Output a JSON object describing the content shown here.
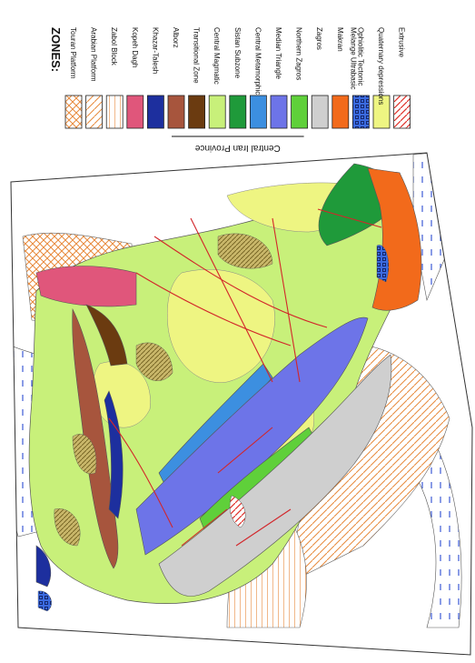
{
  "legend": {
    "title": "ZONES:",
    "group_label": "Central Iran Province",
    "items": [
      {
        "label": "Touran Platform",
        "fill": "#ffffff",
        "pattern": "crosshatch-orange"
      },
      {
        "label": "Arabian Platform",
        "fill": "#ffffff",
        "pattern": "diag-orange"
      },
      {
        "label": "Zabol Block",
        "fill": "#ffffff",
        "pattern": "hlines-orange"
      },
      {
        "label": "Kopeh Dagh",
        "fill": "#e0567b"
      },
      {
        "label": "Khazar-Talesh",
        "fill": "#1d2f9e"
      },
      {
        "label": "Alborz",
        "fill": "#a7553d"
      },
      {
        "label": "Transitional Zone",
        "fill": "#6b3b10"
      },
      {
        "label": "Central Magmatic",
        "fill": "#c8f07a"
      },
      {
        "label": "Sistan Subzone",
        "fill": "#1f9a3a"
      },
      {
        "label": "Central Metamorphic",
        "fill": "#3c8fe0"
      },
      {
        "label": "Median Triangle",
        "fill": "#6d74e8"
      },
      {
        "label": "Northern Zagros",
        "fill": "#5fd03a"
      },
      {
        "label": "Zagros",
        "fill": "#cfcfcf"
      },
      {
        "label": "Makran",
        "fill": "#f26a1b"
      },
      {
        "label": "Ophiolitic Tectonic Melange Ultrabasic",
        "fill": "#3b6be0",
        "pattern": "squares"
      },
      {
        "label": "Quaternary depressions",
        "fill": "#eef582"
      },
      {
        "label": "Extrusive",
        "fill": "#ffffff",
        "pattern": "diag-red"
      }
    ]
  }
}
